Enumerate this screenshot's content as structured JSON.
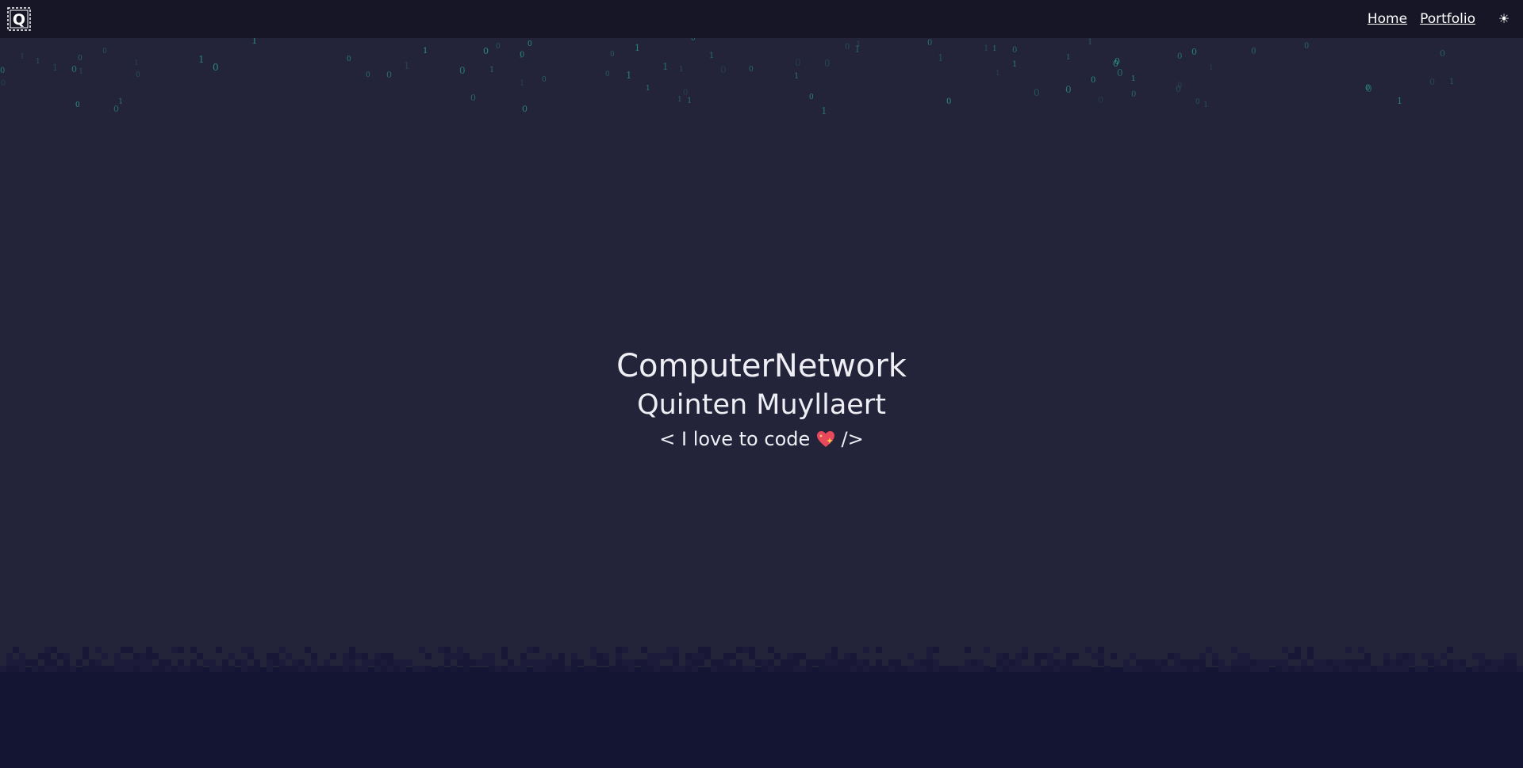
{
  "header": {
    "logo_icon": "q-logo-icon",
    "nav": [
      {
        "label": "Home"
      },
      {
        "label": "Portfolio"
      }
    ],
    "theme_toggle_icon": "sun-icon",
    "theme_toggle_glyph": "☀"
  },
  "hero": {
    "title": "ComputerNetwork",
    "subtitle": "Quinten Muyllaert",
    "tagline_before": "< I love to code",
    "tagline_after": "/>",
    "heart_icon": "sparkling-heart-icon"
  },
  "colors": {
    "background": "#232439",
    "header": "#161627",
    "ground": "#141433",
    "matrix_digit": "#2fb6a0",
    "text": "#eeeef4"
  }
}
